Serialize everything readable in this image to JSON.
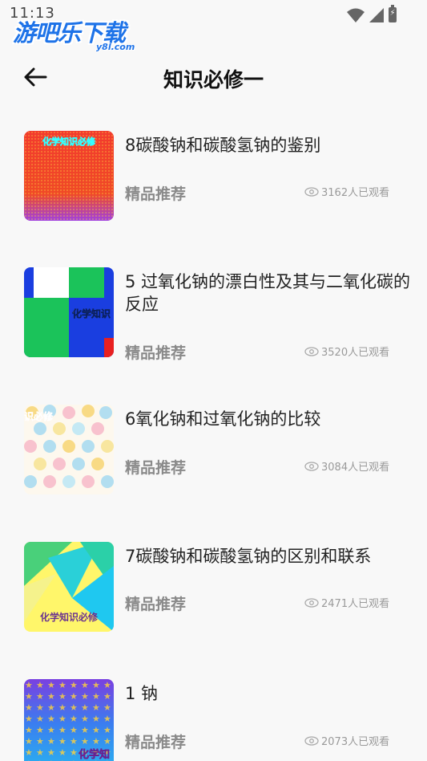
{
  "status_bar": {
    "time": "11:13",
    "watermark_text": "游吧乐下载",
    "watermark_sub": "y8l.com"
  },
  "header": {
    "title": "知识必修一"
  },
  "items": [
    {
      "title": "8碳酸钠和碳酸氢钠的鉴别",
      "tag": "精品推荐",
      "views": "3162人已观看",
      "thumb_text": "化学知识必修"
    },
    {
      "title": "5 过氧化钠的漂白性及其与二氧化碳的反应",
      "tag": "精品推荐",
      "views": "3520人已观看",
      "thumb_text": "化学知识"
    },
    {
      "title": "6氧化钠和过氧化钠的比较",
      "tag": "精品推荐",
      "views": "3084人已观看",
      "thumb_text": "识必修"
    },
    {
      "title": "7碳酸钠和碳酸氢钠的区别和联系",
      "tag": "精品推荐",
      "views": "2471人已观看",
      "thumb_text": "化学知识必修"
    },
    {
      "title": "1 钠",
      "tag": "精品推荐",
      "views": "2073人已观看",
      "thumb_text": "化学知"
    }
  ]
}
